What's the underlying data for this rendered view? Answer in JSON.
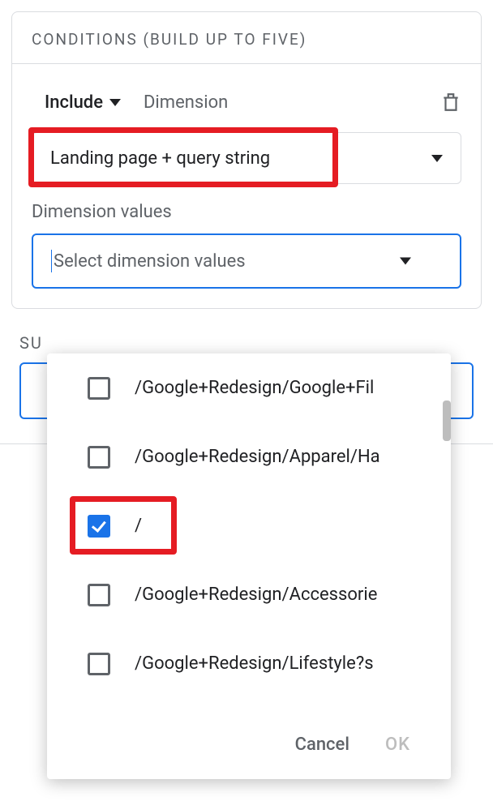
{
  "header": "CONDITIONS (BUILD UP TO FIVE)",
  "include": {
    "label": "Include",
    "dimension_label": "Dimension"
  },
  "dimension_field": {
    "selected": "Landing page + query string"
  },
  "values": {
    "label": "Dimension values",
    "placeholder": "Select dimension values"
  },
  "summary_label": "SU",
  "dropdown": {
    "options": [
      {
        "label": "/Google+Redesign/Google+Fil",
        "checked": false
      },
      {
        "label": "/Google+Redesign/Apparel/Ha",
        "checked": false
      },
      {
        "label": "/",
        "checked": true
      },
      {
        "label": "/Google+Redesign/Accessorie",
        "checked": false
      },
      {
        "label": "/Google+Redesign/Lifestyle?s",
        "checked": false
      }
    ],
    "cancel": "Cancel",
    "ok": "OK"
  }
}
